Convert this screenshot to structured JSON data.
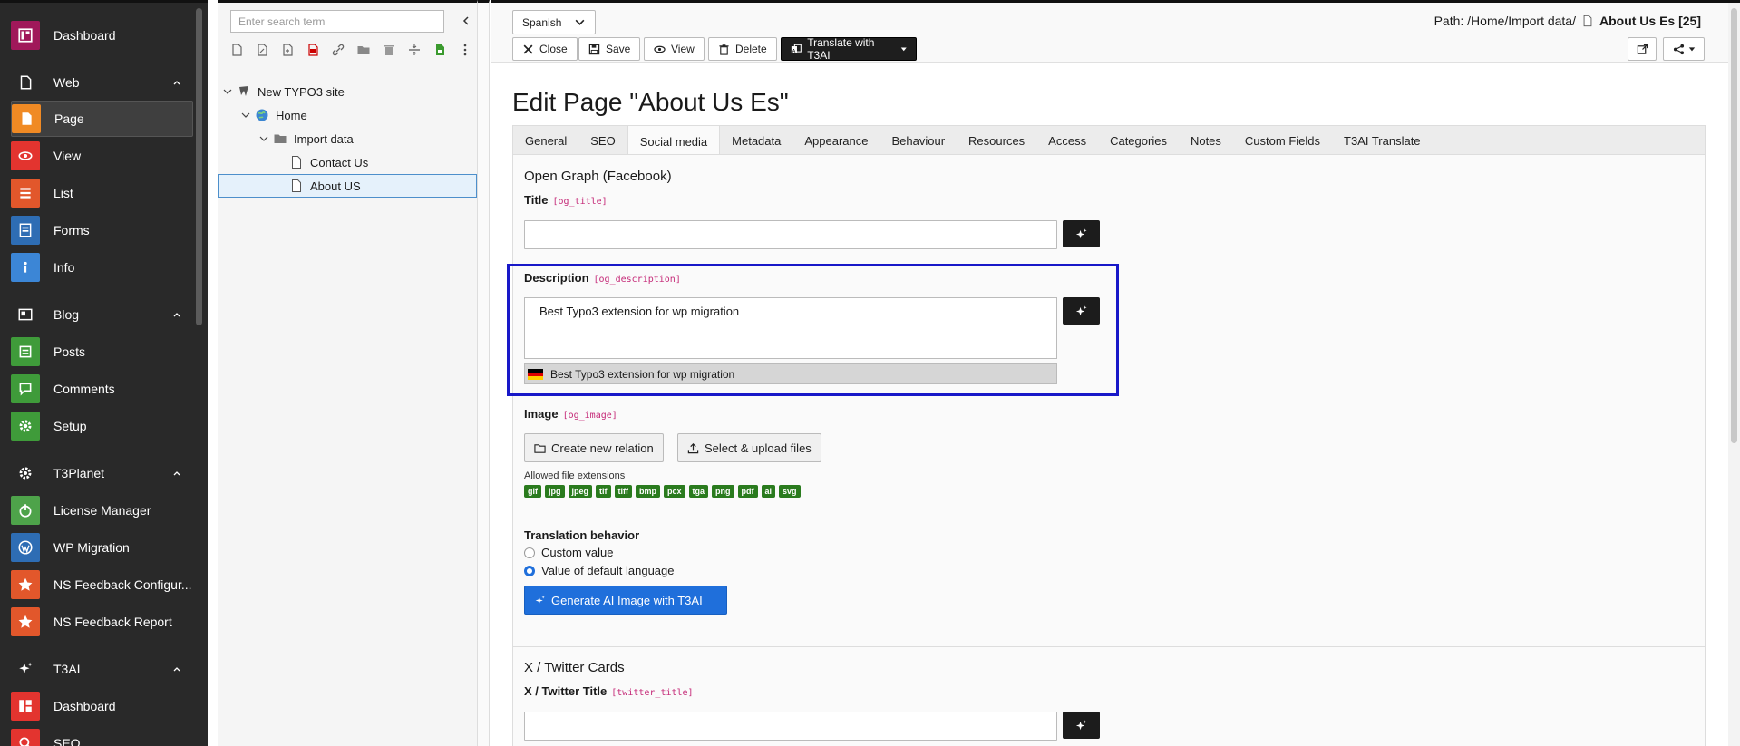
{
  "modules": {
    "dashboard": "Dashboard",
    "web_group": "Web",
    "page": "Page",
    "view": "View",
    "list": "List",
    "forms": "Forms",
    "info": "Info",
    "blog_group": "Blog",
    "posts": "Posts",
    "comments": "Comments",
    "setup": "Setup",
    "t3planet_group": "T3Planet",
    "license_manager": "License Manager",
    "wp_migration": "WP Migration",
    "ns_feedback_config": "NS Feedback Configur...",
    "ns_feedback_report": "NS Feedback Report",
    "t3ai_group": "T3AI",
    "t3ai_dashboard": "Dashboard",
    "seo": "SEO"
  },
  "tree": {
    "search_placeholder": "Enter search term",
    "site": "New TYPO3 site",
    "home": "Home",
    "import_data": "Import data",
    "contact_us": "Contact Us",
    "about_us": "About US"
  },
  "header": {
    "language": "Spanish",
    "close": "Close",
    "save": "Save",
    "view": "View",
    "delete": "Delete",
    "translate": "Translate with T3AI",
    "path_prefix": "Path: /Home/Import data/",
    "path_page": "About Us Es [25]"
  },
  "form": {
    "title": "Edit Page \"About Us Es\"",
    "tabs": [
      "General",
      "SEO",
      "Social media",
      "Metadata",
      "Appearance",
      "Behaviour",
      "Resources",
      "Access",
      "Categories",
      "Notes",
      "Custom Fields",
      "T3AI Translate"
    ],
    "og_section": "Open Graph (Facebook)",
    "og_title_label": "Title",
    "og_title_field": "[og_title]",
    "og_description_label": "Description",
    "og_description_field": "[og_description]",
    "og_description_value": "Best Typo3 extension for wp migration",
    "og_description_default": "Best Typo3 extension for wp migration",
    "og_image_label": "Image",
    "og_image_field": "[og_image]",
    "create_relation": "Create new relation",
    "select_upload": "Select & upload files",
    "allowed_ext_label": "Allowed file extensions",
    "extensions": [
      "gif",
      "jpg",
      "jpeg",
      "tif",
      "tiff",
      "bmp",
      "pcx",
      "tga",
      "png",
      "pdf",
      "ai",
      "svg"
    ],
    "translation_behavior": "Translation behavior",
    "custom_value": "Custom value",
    "default_value": "Value of default language",
    "generate_ai": "Generate AI Image with T3AI",
    "twitter_section": "X / Twitter Cards",
    "twitter_title_label": "X / Twitter Title",
    "twitter_title_field": "[twitter_title]"
  },
  "colors": {
    "accent": "#1f6fdb",
    "highlight": "#1818c8",
    "field_tag": "#c52a78",
    "ext_badge": "#2a7b1e"
  }
}
